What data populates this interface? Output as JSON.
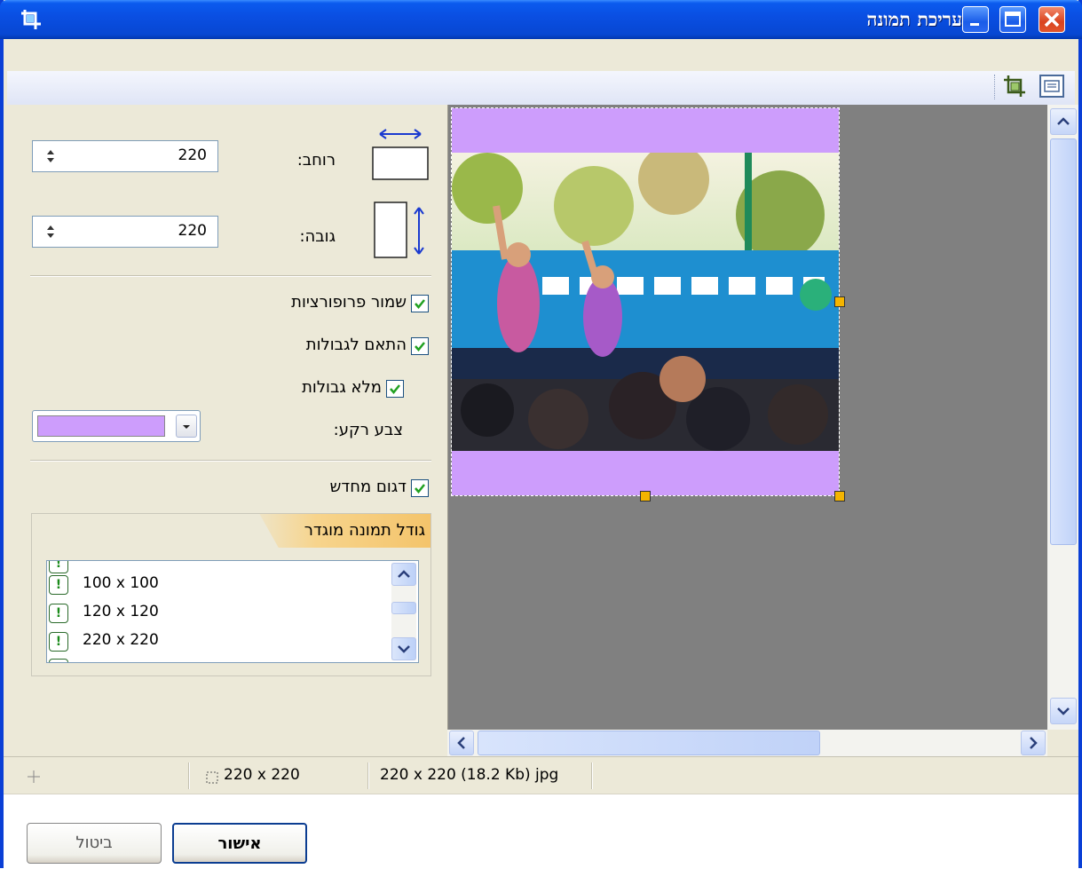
{
  "window": {
    "title": "עריכת תמונה",
    "app_icon": "crop-icon",
    "controls": [
      "minimize-icon",
      "maximize-icon",
      "close-icon"
    ]
  },
  "toolbar": {
    "tools": [
      "crop-tool-icon",
      "fit-to-window-icon"
    ]
  },
  "size": {
    "width_label": "רוחב:",
    "width_value": "220",
    "height_label": "גובה:",
    "height_value": "220"
  },
  "options": {
    "keep_proportions": {
      "label": "שמור פרופורציות",
      "checked": true
    },
    "fit_borders": {
      "label": "התאם לגבולות",
      "checked": true
    },
    "fill_borders": {
      "label": "מלא גבולות",
      "checked": true
    },
    "background_color_label": "צבע רקע:",
    "background_color": "#cd9dfc",
    "resample": {
      "label": "דגום מחדש",
      "checked": true
    }
  },
  "presets": {
    "title": "גודל תמונה מוגדר",
    "items": [
      "100 x 100",
      "120 x 120",
      "220 x 220"
    ]
  },
  "status": {
    "selection": "220 x 220",
    "info": "220 x 220 (18.2 Kb) jpg"
  },
  "buttons": {
    "ok": "אישור",
    "cancel": "ביטול"
  },
  "colors": {
    "titlebar": "#0a4fe3",
    "canvas_bg": "#808080",
    "handle": "#f4b400"
  }
}
